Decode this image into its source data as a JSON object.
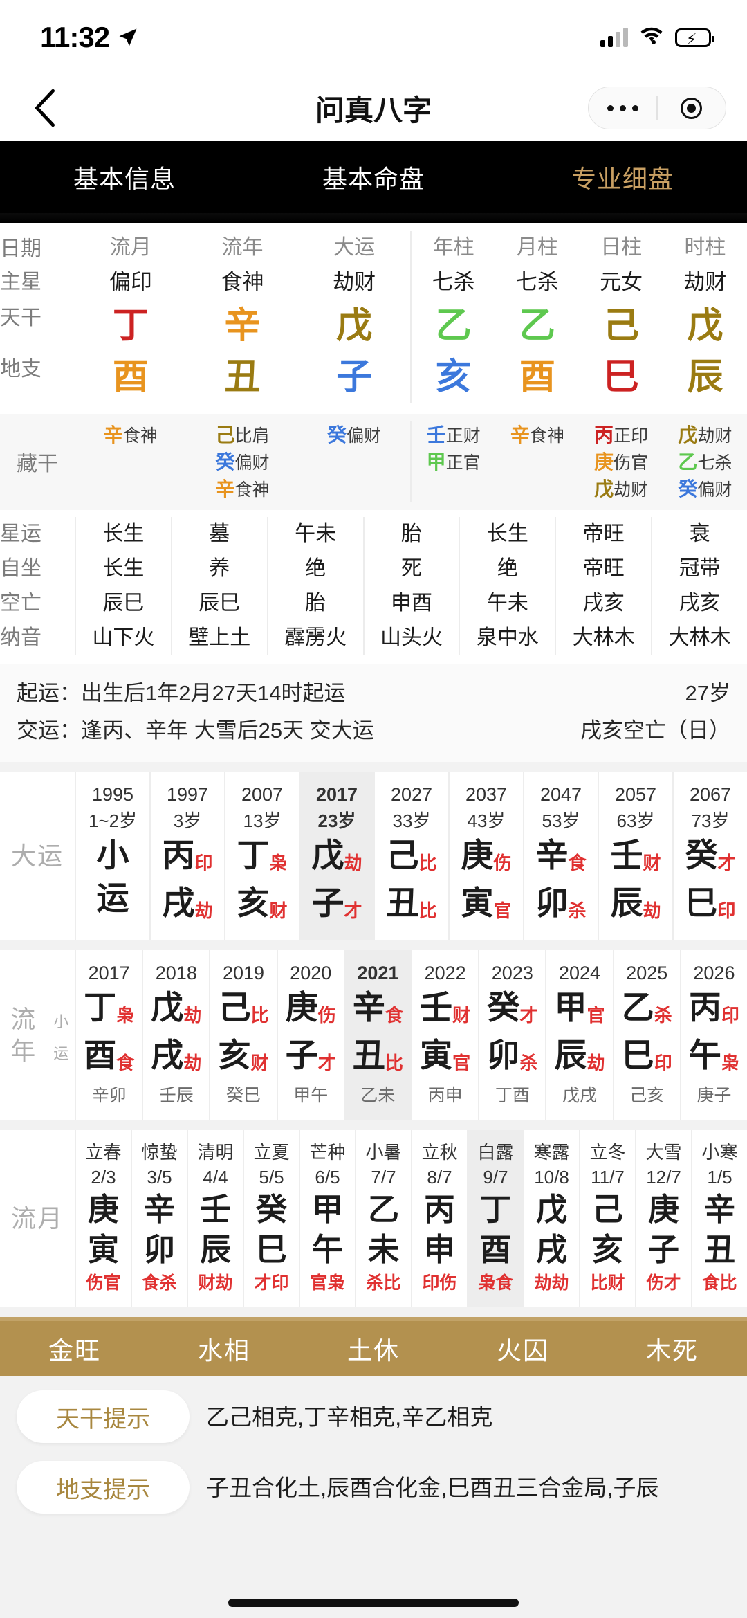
{
  "status_bar": {
    "time": "11:32",
    "location_icon": "location-arrow-icon",
    "signal_icon": "cellular-signal-icon",
    "wifi_icon": "wifi-icon",
    "battery_icon": "battery-charging-icon"
  },
  "nav": {
    "back_icon": "chevron-left-icon",
    "title": "问真八字",
    "more_icon": "more-dots-icon",
    "capsule_icon": "target-ring-icon"
  },
  "tabs": [
    {
      "label": "基本信息",
      "active": false
    },
    {
      "label": "基本命盘",
      "active": false
    },
    {
      "label": "专业细盘",
      "active": true
    }
  ],
  "colors": {
    "accent_gold": "#c9a063",
    "wuxing_bar": "#b3914f",
    "god_red": "#e03131",
    "tab_bg": "#000000"
  },
  "pillars": {
    "row_labels": [
      "日期",
      "主星",
      "天干",
      "地支"
    ],
    "left_group": [
      {
        "header": "流月",
        "main_star": "偏印",
        "stem": "丁",
        "stem_color": "#cc2222",
        "branch": "酉",
        "branch_color": "#e8941f"
      },
      {
        "header": "流年",
        "main_star": "食神",
        "stem": "辛",
        "stem_color": "#e8941f",
        "branch": "丑",
        "branch_color": "#9a7b12"
      },
      {
        "header": "大运",
        "main_star": "劫财",
        "stem": "戊",
        "stem_color": "#9a7b12",
        "branch": "子",
        "branch_color": "#3c78dc"
      }
    ],
    "right_group": [
      {
        "header": "年柱",
        "main_star": "七杀",
        "stem": "乙",
        "stem_color": "#5ec84f",
        "branch": "亥",
        "branch_color": "#3c78dc"
      },
      {
        "header": "月柱",
        "main_star": "七杀",
        "stem": "乙",
        "stem_color": "#5ec84f",
        "branch": "酉",
        "branch_color": "#e8941f"
      },
      {
        "header": "日柱",
        "main_star": "元女",
        "stem": "己",
        "stem_color": "#9a7b12",
        "branch": "巳",
        "branch_color": "#cc2222"
      },
      {
        "header": "时柱",
        "main_star": "劫财",
        "stem": "戊",
        "stem_color": "#9a7b12",
        "branch": "辰",
        "branch_color": "#9a7b12"
      }
    ]
  },
  "hidden_stems": {
    "label": "藏干",
    "left_group": [
      {
        "items": [
          {
            "stem": "辛",
            "color": "#e8941f",
            "god": "食神"
          }
        ]
      },
      {
        "items": [
          {
            "stem": "己",
            "color": "#9a7b12",
            "god": "比肩"
          },
          {
            "stem": "癸",
            "color": "#3c78dc",
            "god": "偏财"
          },
          {
            "stem": "辛",
            "color": "#e8941f",
            "god": "食神"
          }
        ]
      },
      {
        "items": [
          {
            "stem": "癸",
            "color": "#3c78dc",
            "god": "偏财"
          }
        ]
      }
    ],
    "right_group": [
      {
        "items": [
          {
            "stem": "壬",
            "color": "#3c78dc",
            "god": "正财"
          },
          {
            "stem": "甲",
            "color": "#5ec84f",
            "god": "正官"
          }
        ]
      },
      {
        "items": [
          {
            "stem": "辛",
            "color": "#e8941f",
            "god": "食神"
          }
        ]
      },
      {
        "items": [
          {
            "stem": "丙",
            "color": "#cc2222",
            "god": "正印"
          },
          {
            "stem": "庚",
            "color": "#e8941f",
            "god": "伤官"
          },
          {
            "stem": "戊",
            "color": "#9a7b12",
            "god": "劫财"
          }
        ]
      },
      {
        "items": [
          {
            "stem": "戊",
            "color": "#9a7b12",
            "god": "劫财"
          },
          {
            "stem": "乙",
            "color": "#5ec84f",
            "god": "七杀"
          },
          {
            "stem": "癸",
            "color": "#3c78dc",
            "god": "偏财"
          }
        ]
      }
    ]
  },
  "star_rows": {
    "labels": [
      "星运",
      "自坐",
      "空亡",
      "纳音"
    ],
    "columns": [
      {
        "xingyun": "长生",
        "zizuo": "长生",
        "kongwang": "辰巳",
        "nayin": "山下火"
      },
      {
        "xingyun": "墓",
        "zizuo": "养",
        "kongwang": "辰巳",
        "nayin": "壁上土"
      },
      {
        "xingyun": "午未",
        "zizuo": "绝",
        "kongwang": "胎",
        "nayin": "霹雳火"
      },
      {
        "xingyun": "胎",
        "zizuo": "死",
        "kongwang": "申酉",
        "nayin": "山头火"
      },
      {
        "xingyun": "长生",
        "zizuo": "绝",
        "kongwang": "午未",
        "nayin": "泉中水"
      },
      {
        "xingyun": "帝旺",
        "zizuo": "帝旺",
        "kongwang": "戌亥",
        "nayin": "大林木"
      },
      {
        "xingyun": "衰",
        "zizuo": "冠带",
        "kongwang": "戌亥",
        "nayin": "大林木"
      }
    ]
  },
  "qiyun": {
    "line1_label": "起运：",
    "line1_value": "出生后1年2月27天14时起运",
    "line1_right": "27岁",
    "line2_label": "交运：",
    "line2_value": "逢丙、辛年 大雪后25天 交大运",
    "line2_right": "戌亥空亡（日）"
  },
  "dayun": {
    "label": "大运",
    "cells": [
      {
        "year": "1995",
        "age": "1~2岁",
        "stem": "小",
        "stem_god": "",
        "branch": "运",
        "branch_god": "",
        "selected": false
      },
      {
        "year": "1997",
        "age": "3岁",
        "stem": "丙",
        "stem_god": "印",
        "branch": "戌",
        "branch_god": "劫",
        "selected": false
      },
      {
        "year": "2007",
        "age": "13岁",
        "stem": "丁",
        "stem_god": "枭",
        "branch": "亥",
        "branch_god": "财",
        "selected": false
      },
      {
        "year": "2017",
        "age": "23岁",
        "stem": "戊",
        "stem_god": "劫",
        "branch": "子",
        "branch_god": "才",
        "selected": true
      },
      {
        "year": "2027",
        "age": "33岁",
        "stem": "己",
        "stem_god": "比",
        "branch": "丑",
        "branch_god": "比",
        "selected": false
      },
      {
        "year": "2037",
        "age": "43岁",
        "stem": "庚",
        "stem_god": "伤",
        "branch": "寅",
        "branch_god": "官",
        "selected": false
      },
      {
        "year": "2047",
        "age": "53岁",
        "stem": "辛",
        "stem_god": "食",
        "branch": "卯",
        "branch_god": "杀",
        "selected": false
      },
      {
        "year": "2057",
        "age": "63岁",
        "stem": "壬",
        "stem_god": "财",
        "branch": "辰",
        "branch_god": "劫",
        "selected": false
      },
      {
        "year": "2067",
        "age": "73岁",
        "stem": "癸",
        "stem_god": "才",
        "branch": "巳",
        "branch_god": "印",
        "selected": false
      }
    ]
  },
  "liunian": {
    "label": "流年",
    "sublabel": "小运",
    "cells": [
      {
        "year": "2017",
        "stem": "丁",
        "stem_god": "枭",
        "branch": "酉",
        "branch_god": "食",
        "xiaoyun": "辛卯",
        "selected": false
      },
      {
        "year": "2018",
        "stem": "戊",
        "stem_god": "劫",
        "branch": "戌",
        "branch_god": "劫",
        "xiaoyun": "壬辰",
        "selected": false
      },
      {
        "year": "2019",
        "stem": "己",
        "stem_god": "比",
        "branch": "亥",
        "branch_god": "财",
        "xiaoyun": "癸巳",
        "selected": false
      },
      {
        "year": "2020",
        "stem": "庚",
        "stem_god": "伤",
        "branch": "子",
        "branch_god": "才",
        "xiaoyun": "甲午",
        "selected": false
      },
      {
        "year": "2021",
        "stem": "辛",
        "stem_god": "食",
        "branch": "丑",
        "branch_god": "比",
        "xiaoyun": "乙未",
        "selected": true
      },
      {
        "year": "2022",
        "stem": "壬",
        "stem_god": "财",
        "branch": "寅",
        "branch_god": "官",
        "xiaoyun": "丙申",
        "selected": false
      },
      {
        "year": "2023",
        "stem": "癸",
        "stem_god": "才",
        "branch": "卯",
        "branch_god": "杀",
        "xiaoyun": "丁酉",
        "selected": false
      },
      {
        "year": "2024",
        "stem": "甲",
        "stem_god": "官",
        "branch": "辰",
        "branch_god": "劫",
        "xiaoyun": "戊戌",
        "selected": false
      },
      {
        "year": "2025",
        "stem": "乙",
        "stem_god": "杀",
        "branch": "巳",
        "branch_god": "印",
        "xiaoyun": "己亥",
        "selected": false
      },
      {
        "year": "2026",
        "stem": "丙",
        "stem_god": "印",
        "branch": "午",
        "branch_god": "枭",
        "xiaoyun": "庚子",
        "selected": false
      }
    ]
  },
  "liuyue": {
    "label": "流月",
    "cells": [
      {
        "term": "立春",
        "date": "2/3",
        "stem": "庚",
        "branch": "寅",
        "gods": "伤官",
        "selected": false
      },
      {
        "term": "惊蛰",
        "date": "3/5",
        "stem": "辛",
        "branch": "卯",
        "gods": "食杀",
        "selected": false
      },
      {
        "term": "清明",
        "date": "4/4",
        "stem": "壬",
        "branch": "辰",
        "gods": "财劫",
        "selected": false
      },
      {
        "term": "立夏",
        "date": "5/5",
        "stem": "癸",
        "branch": "巳",
        "gods": "才印",
        "selected": false
      },
      {
        "term": "芒种",
        "date": "6/5",
        "stem": "甲",
        "branch": "午",
        "gods": "官枭",
        "selected": false
      },
      {
        "term": "小暑",
        "date": "7/7",
        "stem": "乙",
        "branch": "未",
        "gods": "杀比",
        "selected": false
      },
      {
        "term": "立秋",
        "date": "8/7",
        "stem": "丙",
        "branch": "申",
        "gods": "印伤",
        "selected": false
      },
      {
        "term": "白露",
        "date": "9/7",
        "stem": "丁",
        "branch": "酉",
        "gods": "枭食",
        "selected": true
      },
      {
        "term": "寒露",
        "date": "10/8",
        "stem": "戊",
        "branch": "戌",
        "gods": "劫劫",
        "selected": false
      },
      {
        "term": "立冬",
        "date": "11/7",
        "stem": "己",
        "branch": "亥",
        "gods": "比财",
        "selected": false
      },
      {
        "term": "大雪",
        "date": "12/7",
        "stem": "庚",
        "branch": "子",
        "gods": "伤才",
        "selected": false
      },
      {
        "term": "小寒",
        "date": "1/5",
        "stem": "辛",
        "branch": "丑",
        "gods": "食比",
        "selected": false
      }
    ]
  },
  "wuxing_bar": [
    "金旺",
    "水相",
    "土休",
    "火囚",
    "木死"
  ],
  "tips": [
    {
      "chip": "天干提示",
      "text": "乙己相克,丁辛相克,辛乙相克"
    },
    {
      "chip": "地支提示",
      "text": "子丑合化土,辰酉合化金,巳酉丑三合金局,子辰"
    }
  ]
}
